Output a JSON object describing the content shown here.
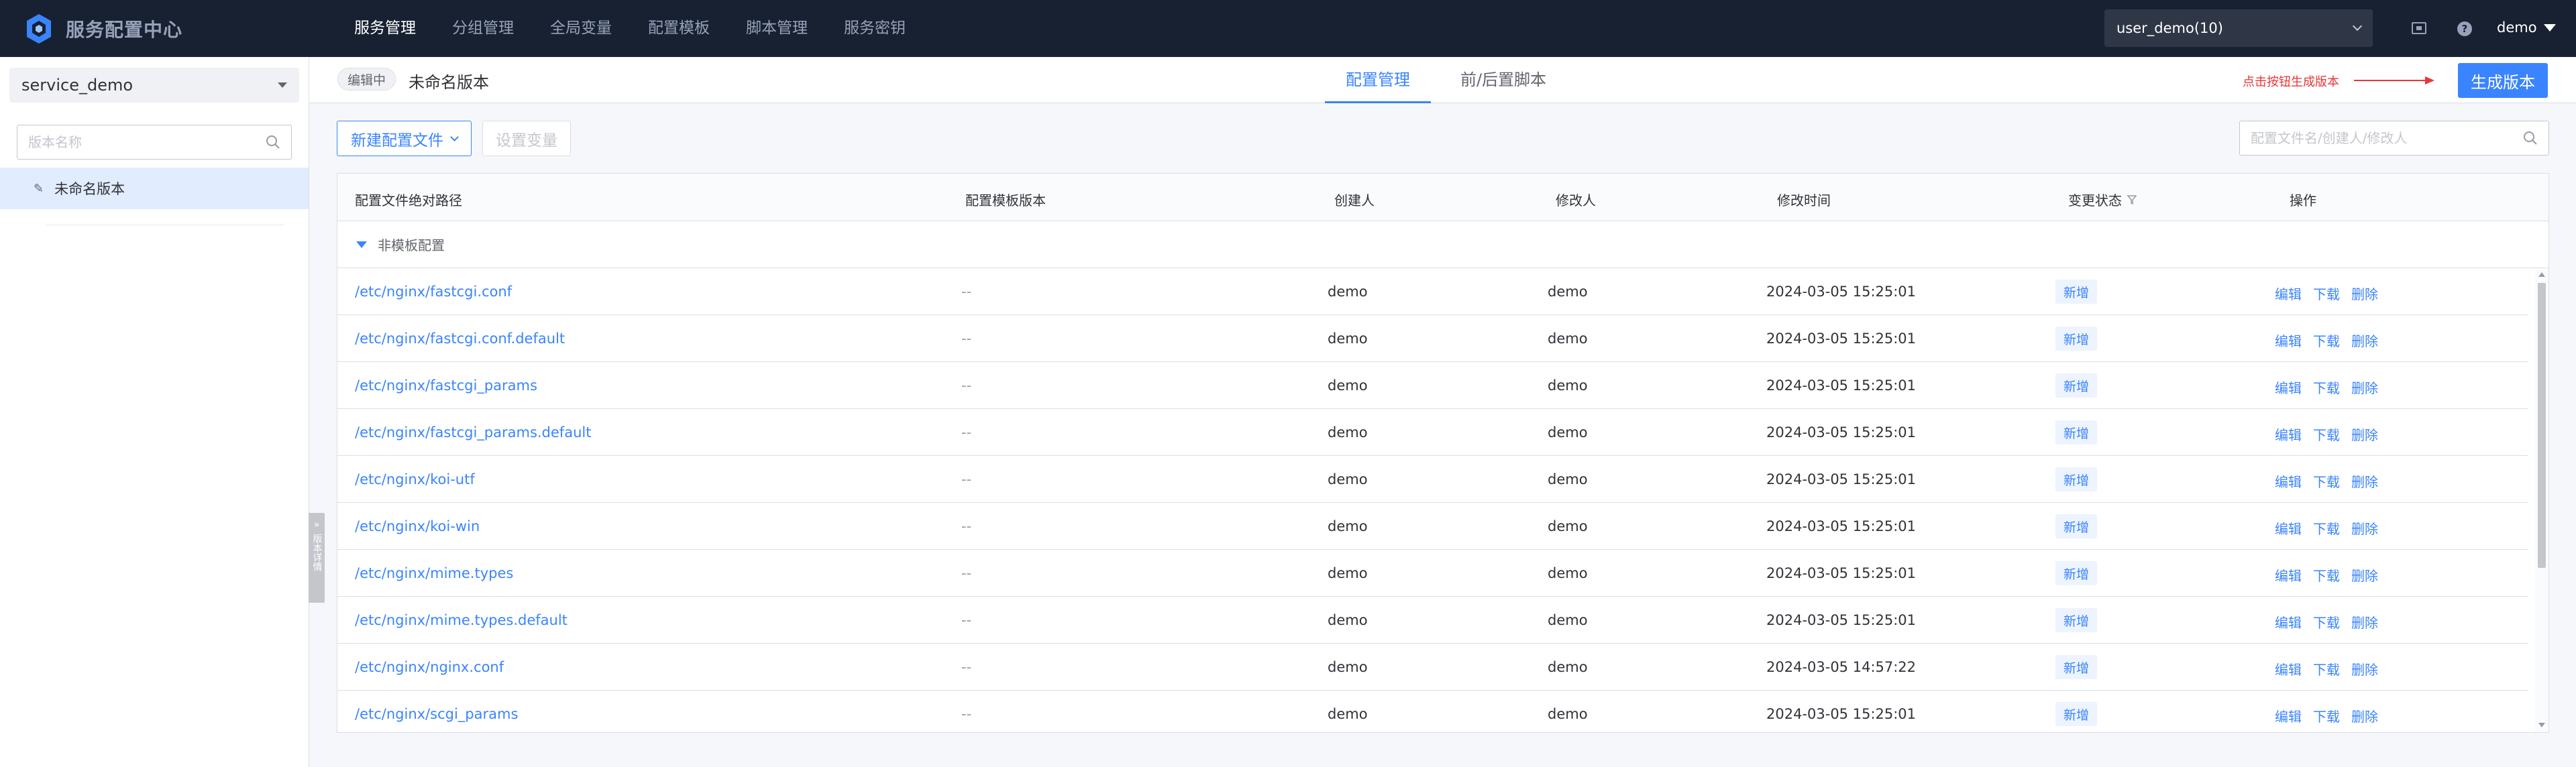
{
  "colors": {
    "nav_bg": "#182132",
    "primary": "#3a84ff",
    "hint_red": "#ea3636",
    "selected_bg": "#e1ecff"
  },
  "header": {
    "brand_title": "服务配置中心",
    "nav": [
      {
        "label": "服务管理",
        "active": true
      },
      {
        "label": "分组管理",
        "active": false
      },
      {
        "label": "全局变量",
        "active": false
      },
      {
        "label": "配置模板",
        "active": false
      },
      {
        "label": "脚本管理",
        "active": false
      },
      {
        "label": "服务密钥",
        "active": false
      }
    ],
    "business_select": "user_demo(10)",
    "icons": [
      "screen-icon",
      "help-icon"
    ],
    "user": "demo"
  },
  "sidebar": {
    "service_select": "service_demo",
    "version_search_placeholder": "版本名称",
    "versions": [
      {
        "label": "未命名版本",
        "selected": true,
        "icon": "pen-icon"
      }
    ],
    "collapse_tab": "版本详情"
  },
  "version_header": {
    "status_tag": "编辑中",
    "version_name": "未命名版本",
    "tabs": [
      {
        "label": "配置管理",
        "active": true
      },
      {
        "label": "前/后置脚本",
        "active": false
      }
    ],
    "hint": "点击按钮生成版本",
    "generate_button": "生成版本"
  },
  "toolbar": {
    "new_config_button": "新建配置文件",
    "set_variable_button": "设置变量",
    "search_placeholder": "配置文件名/创建人/修改人"
  },
  "table": {
    "columns": [
      "配置文件绝对路径",
      "配置模板版本",
      "创建人",
      "修改人",
      "修改时间",
      "变更状态",
      "操作"
    ],
    "group": "非模板配置",
    "rows": [
      {
        "path": "/etc/nginx/fastcgi.conf",
        "template": "--",
        "creator": "demo",
        "modifier": "demo",
        "time": "2024-03-05 15:25:01",
        "status": "新增",
        "ops": [
          "编辑",
          "下载",
          "删除"
        ]
      },
      {
        "path": "/etc/nginx/fastcgi.conf.default",
        "template": "--",
        "creator": "demo",
        "modifier": "demo",
        "time": "2024-03-05 15:25:01",
        "status": "新增",
        "ops": [
          "编辑",
          "下载",
          "删除"
        ]
      },
      {
        "path": "/etc/nginx/fastcgi_params",
        "template": "--",
        "creator": "demo",
        "modifier": "demo",
        "time": "2024-03-05 15:25:01",
        "status": "新增",
        "ops": [
          "编辑",
          "下载",
          "删除"
        ]
      },
      {
        "path": "/etc/nginx/fastcgi_params.default",
        "template": "--",
        "creator": "demo",
        "modifier": "demo",
        "time": "2024-03-05 15:25:01",
        "status": "新增",
        "ops": [
          "编辑",
          "下载",
          "删除"
        ]
      },
      {
        "path": "/etc/nginx/koi-utf",
        "template": "--",
        "creator": "demo",
        "modifier": "demo",
        "time": "2024-03-05 15:25:01",
        "status": "新增",
        "ops": [
          "编辑",
          "下载",
          "删除"
        ]
      },
      {
        "path": "/etc/nginx/koi-win",
        "template": "--",
        "creator": "demo",
        "modifier": "demo",
        "time": "2024-03-05 15:25:01",
        "status": "新增",
        "ops": [
          "编辑",
          "下载",
          "删除"
        ]
      },
      {
        "path": "/etc/nginx/mime.types",
        "template": "--",
        "creator": "demo",
        "modifier": "demo",
        "time": "2024-03-05 15:25:01",
        "status": "新增",
        "ops": [
          "编辑",
          "下载",
          "删除"
        ]
      },
      {
        "path": "/etc/nginx/mime.types.default",
        "template": "--",
        "creator": "demo",
        "modifier": "demo",
        "time": "2024-03-05 15:25:01",
        "status": "新增",
        "ops": [
          "编辑",
          "下载",
          "删除"
        ]
      },
      {
        "path": "/etc/nginx/nginx.conf",
        "template": "--",
        "creator": "demo",
        "modifier": "demo",
        "time": "2024-03-05 14:57:22",
        "status": "新增",
        "ops": [
          "编辑",
          "下载",
          "删除"
        ]
      },
      {
        "path": "/etc/nginx/scgi_params",
        "template": "--",
        "creator": "demo",
        "modifier": "demo",
        "time": "2024-03-05 15:25:01",
        "status": "新增",
        "ops": [
          "编辑",
          "下载",
          "删除"
        ]
      }
    ]
  }
}
